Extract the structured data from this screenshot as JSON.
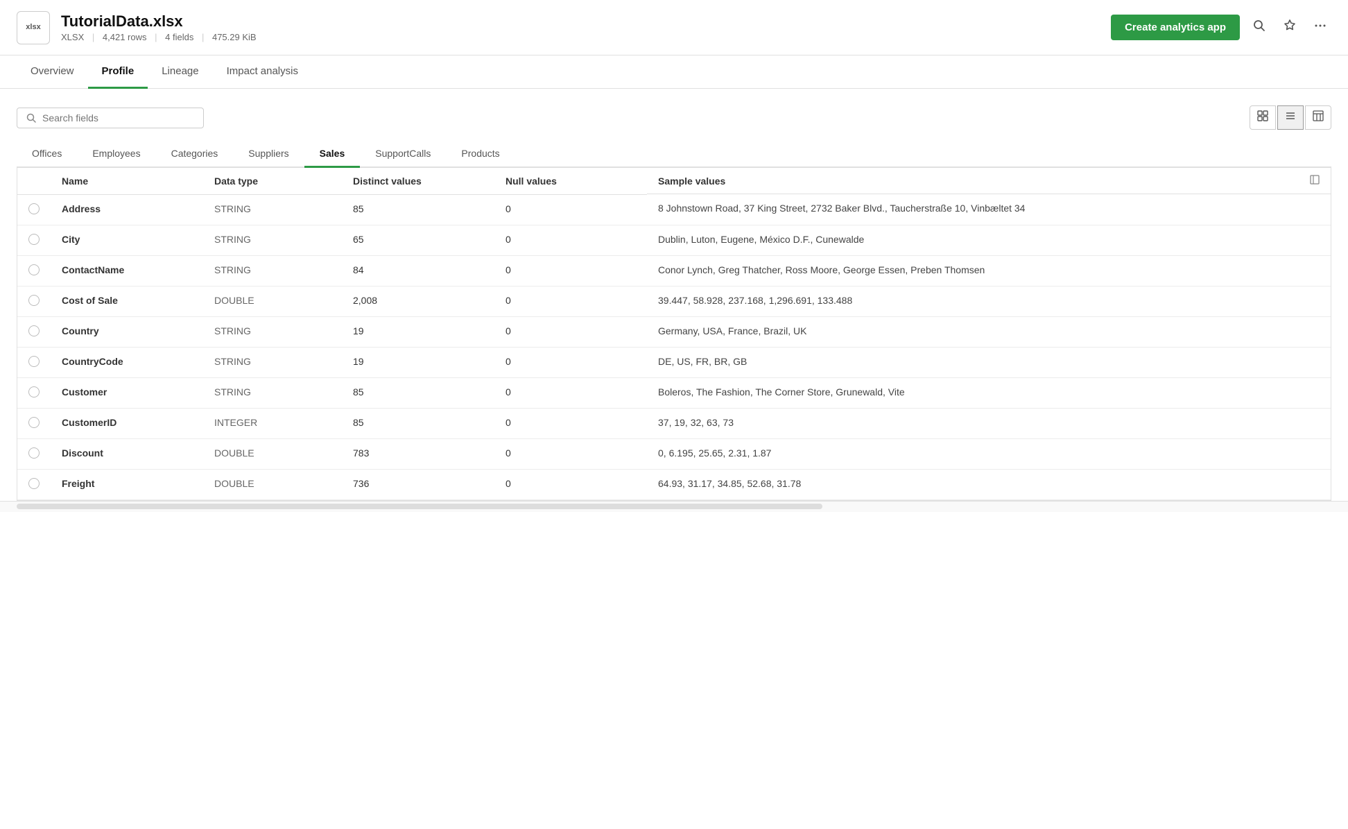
{
  "header": {
    "file_icon_text": "xlsx",
    "file_title": "TutorialData.xlsx",
    "file_format": "XLSX",
    "file_rows": "4,421 rows",
    "file_fields": "4 fields",
    "file_size": "475.29 KiB",
    "create_btn_label": "Create analytics app"
  },
  "nav": {
    "tabs": [
      {
        "id": "overview",
        "label": "Overview",
        "active": false
      },
      {
        "id": "profile",
        "label": "Profile",
        "active": true
      },
      {
        "id": "lineage",
        "label": "Lineage",
        "active": false
      },
      {
        "id": "impact",
        "label": "Impact analysis",
        "active": false
      }
    ]
  },
  "search": {
    "placeholder": "Search fields",
    "label": "Search fields"
  },
  "view_controls": {
    "grid_label": "Grid view",
    "list_label": "List view",
    "table_label": "Table view"
  },
  "sheet_tabs": [
    {
      "id": "offices",
      "label": "Offices"
    },
    {
      "id": "employees",
      "label": "Employees"
    },
    {
      "id": "categories",
      "label": "Categories"
    },
    {
      "id": "suppliers",
      "label": "Suppliers"
    },
    {
      "id": "sales",
      "label": "Sales",
      "active": true
    },
    {
      "id": "support_calls",
      "label": "SupportCalls"
    },
    {
      "id": "products",
      "label": "Products"
    }
  ],
  "table": {
    "headers": [
      {
        "id": "select",
        "label": ""
      },
      {
        "id": "name",
        "label": "Name"
      },
      {
        "id": "data_type",
        "label": "Data type"
      },
      {
        "id": "distinct_values",
        "label": "Distinct values"
      },
      {
        "id": "null_values",
        "label": "Null values"
      },
      {
        "id": "sample_values",
        "label": "Sample values"
      }
    ],
    "rows": [
      {
        "id": "address",
        "name": "Address",
        "data_type": "STRING",
        "distinct_values": "85",
        "null_values": "0",
        "sample_values": "8 Johnstown Road, 37 King Street, 2732 Baker Blvd., Taucherstraße 10, Vinbæltet 34"
      },
      {
        "id": "city",
        "name": "City",
        "data_type": "STRING",
        "distinct_values": "65",
        "null_values": "0",
        "sample_values": "Dublin, Luton, Eugene, México D.F., Cunewalde"
      },
      {
        "id": "contact_name",
        "name": "ContactName",
        "data_type": "STRING",
        "distinct_values": "84",
        "null_values": "0",
        "sample_values": "Conor Lynch, Greg Thatcher, Ross Moore, George Essen, Preben Thomsen"
      },
      {
        "id": "cost_of_sale",
        "name": "Cost of Sale",
        "data_type": "DOUBLE",
        "distinct_values": "2,008",
        "null_values": "0",
        "sample_values": "39.447, 58.928, 237.168, 1,296.691, 133.488"
      },
      {
        "id": "country",
        "name": "Country",
        "data_type": "STRING",
        "distinct_values": "19",
        "null_values": "0",
        "sample_values": "Germany, USA, France, Brazil, UK"
      },
      {
        "id": "country_code",
        "name": "CountryCode",
        "data_type": "STRING",
        "distinct_values": "19",
        "null_values": "0",
        "sample_values": "DE, US, FR, BR, GB"
      },
      {
        "id": "customer",
        "name": "Customer",
        "data_type": "STRING",
        "distinct_values": "85",
        "null_values": "0",
        "sample_values": "Boleros, The Fashion, The Corner Store, Grunewald, Vite"
      },
      {
        "id": "customer_id",
        "name": "CustomerID",
        "data_type": "INTEGER",
        "distinct_values": "85",
        "null_values": "0",
        "sample_values": "37, 19, 32, 63, 73"
      },
      {
        "id": "discount",
        "name": "Discount",
        "data_type": "DOUBLE",
        "distinct_values": "783",
        "null_values": "0",
        "sample_values": "0, 6.195, 25.65, 2.31, 1.87"
      },
      {
        "id": "freight",
        "name": "Freight",
        "data_type": "DOUBLE",
        "distinct_values": "736",
        "null_values": "0",
        "sample_values": "64.93, 31.17, 34.85, 52.68, 31.78"
      }
    ]
  }
}
